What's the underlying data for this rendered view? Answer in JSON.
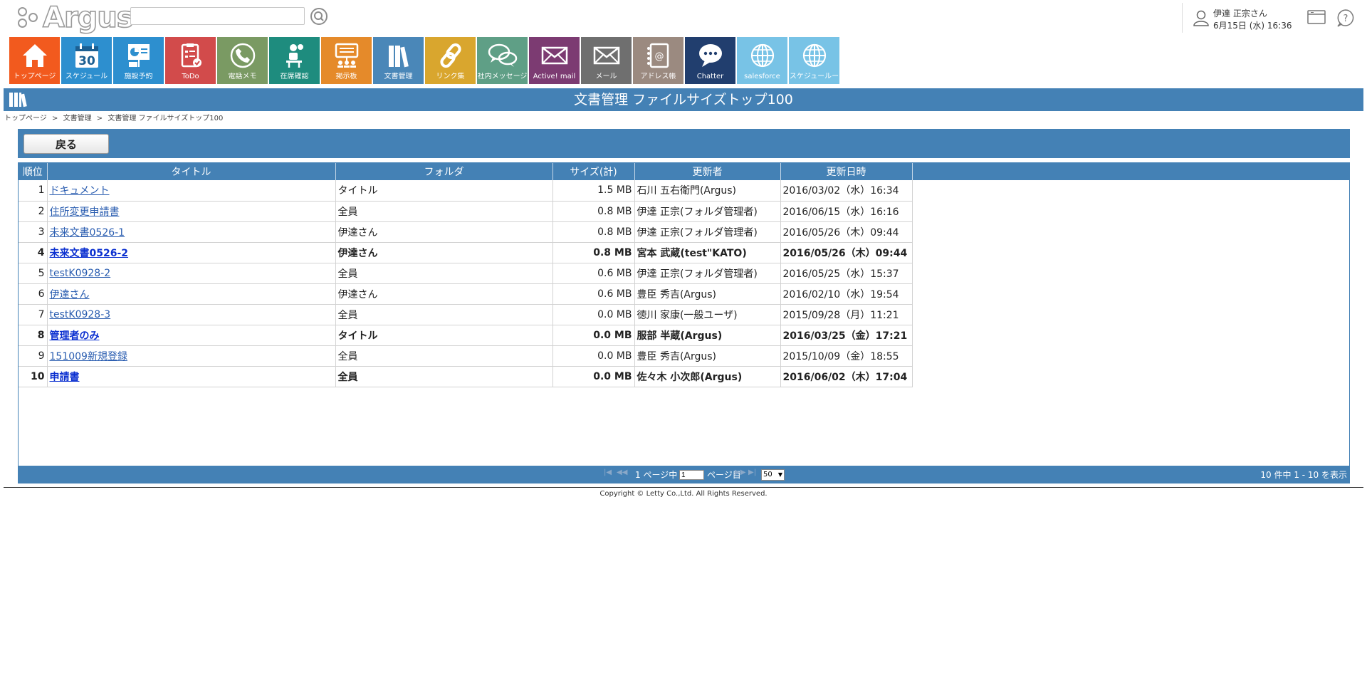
{
  "brand": {
    "logo_text": "Argus"
  },
  "search": {
    "placeholder": "",
    "value": ""
  },
  "user": {
    "name": "伊達 正宗さん",
    "datetime": "6月15日 (水) 16:36"
  },
  "apps": [
    {
      "label": "トップページ",
      "icon": "home-icon",
      "color": "#f25a1e"
    },
    {
      "label": "スケジュール",
      "icon": "calendar-icon",
      "color": "#2d8fcf",
      "day": "30"
    },
    {
      "label": "施設予約",
      "icon": "presentation-icon",
      "color": "#2d8fcf"
    },
    {
      "label": "ToDo",
      "icon": "todo-icon",
      "color": "#d24b4b"
    },
    {
      "label": "電話メモ",
      "icon": "phone-icon",
      "color": "#7a9a63"
    },
    {
      "label": "在席確認",
      "icon": "presence-icon",
      "color": "#1e8c7e"
    },
    {
      "label": "掲示板",
      "icon": "bulletin-board-icon",
      "color": "#e58a2a"
    },
    {
      "label": "文書管理",
      "icon": "documents-icon",
      "color": "#4a87b8"
    },
    {
      "label": "リンク集",
      "icon": "link-icon",
      "color": "#d9a62e"
    },
    {
      "label": "社内メッセージ",
      "icon": "chat-bubbles-icon",
      "color": "#5f9f86"
    },
    {
      "label": "Active! mail",
      "icon": "envelope-icon",
      "color": "#7c3b72"
    },
    {
      "label": "メール",
      "icon": "envelope-icon",
      "color": "#6f6f6f"
    },
    {
      "label": "アドレス帳",
      "icon": "address-book-icon",
      "color": "#9b8a80"
    },
    {
      "label": "Chatter",
      "icon": "speech-bubble-icon",
      "color": "#213e6e"
    },
    {
      "label": "salesforce",
      "icon": "globe-icon",
      "color": "#78c3e6"
    },
    {
      "label": "スケジュールー",
      "icon": "globe-icon",
      "color": "#78c3e6"
    }
  ],
  "page": {
    "title": "文書管理 ファイルサイズトップ100",
    "breadcrumb": [
      "トップページ",
      "文書管理",
      "文書管理 ファイルサイズトップ100"
    ],
    "breadcrumb_sep": ">"
  },
  "toolbar": {
    "back_label": "戻る"
  },
  "table": {
    "columns": [
      "順位",
      "タイトル",
      "フォルダ",
      "サイズ(計)",
      "更新者",
      "更新日時"
    ],
    "rows": [
      {
        "rank": "1",
        "title": "ドキュメント",
        "folder": "タイトル",
        "size": "1.5 MB",
        "updater": "石川 五右衛門(Argus)",
        "updated": "2016/03/02（水）16:34",
        "bold": false
      },
      {
        "rank": "2",
        "title": "住所変更申請書",
        "folder": "全員",
        "size": "0.8 MB",
        "updater": "伊達 正宗(フォルダ管理者)",
        "updated": "2016/06/15（水）16:16",
        "bold": false
      },
      {
        "rank": "3",
        "title": "未来文書0526-1",
        "folder": "伊達さん",
        "size": "0.8 MB",
        "updater": "伊達 正宗(フォルダ管理者)",
        "updated": "2016/05/26（木）09:44",
        "bold": false
      },
      {
        "rank": "4",
        "title": "未来文書0526-2",
        "folder": "伊達さん",
        "size": "0.8 MB",
        "updater": "宮本 武蔵(test\"KATO)",
        "updated": "2016/05/26（木）09:44",
        "bold": true
      },
      {
        "rank": "5",
        "title": "testK0928-2",
        "folder": "全員",
        "size": "0.6 MB",
        "updater": "伊達 正宗(フォルダ管理者)",
        "updated": "2016/05/25（水）15:37",
        "bold": false
      },
      {
        "rank": "6",
        "title": "伊達さん",
        "folder": "伊達さん",
        "size": "0.6 MB",
        "updater": "豊臣 秀吉(Argus)",
        "updated": "2016/02/10（水）19:54",
        "bold": false
      },
      {
        "rank": "7",
        "title": "testK0928-3",
        "folder": "全員",
        "size": "0.0 MB",
        "updater": "徳川 家康(一般ユーザ)",
        "updated": "2015/09/28（月）11:21",
        "bold": false
      },
      {
        "rank": "8",
        "title": "管理者のみ",
        "folder": "タイトル",
        "size": "0.0 MB",
        "updater": "服部 半蔵(Argus)",
        "updated": "2016/03/25（金）17:21",
        "bold": true
      },
      {
        "rank": "9",
        "title": "151009新規登録",
        "folder": "全員",
        "size": "0.0 MB",
        "updater": "豊臣 秀吉(Argus)",
        "updated": "2015/10/09（金）18:55",
        "bold": false
      },
      {
        "rank": "10",
        "title": "申請書",
        "folder": "全員",
        "size": "0.0 MB",
        "updater": "佐々木 小次郎(Argus)",
        "updated": "2016/06/02（木）17:04",
        "bold": true
      }
    ]
  },
  "pager": {
    "first": "|◀",
    "prev": "◀◀",
    "page_text": "1 ページ中",
    "page_value": "1",
    "page_suffix": "ページ目",
    "next": "▶▶",
    "last": "▶|",
    "page_size": "50",
    "summary": "10 件中 1 - 10 を表示"
  },
  "footer": {
    "copyright": "Copyright © Letty Co.,Ltd. All Rights Reserved."
  },
  "colors": {
    "accent": "#4481b5",
    "link": "#2a5db0"
  }
}
